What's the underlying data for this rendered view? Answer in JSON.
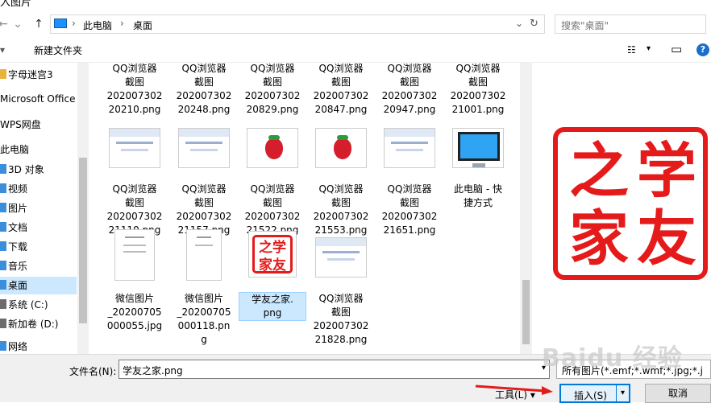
{
  "window": {
    "title_fragment": "入图片"
  },
  "nav": {
    "back": "←",
    "forward": "→",
    "down": "⌄",
    "up": "↑"
  },
  "address": {
    "crumb1": "此电脑",
    "crumb2": "桌面",
    "dropdown": "⌄",
    "refresh": "↻"
  },
  "search": {
    "placeholder": "搜索\"桌面\""
  },
  "toolbar": {
    "new_folder": "新建文件夹",
    "view_label": "☷",
    "view_arrow": "▾",
    "pane_icon": "▭",
    "help": "?"
  },
  "left_pane": [
    {
      "label": "字母迷宫3",
      "icon": "folder-icon",
      "color": "#e8b33c"
    },
    {
      "label": "Microsoft Office",
      "icon": "",
      "color": ""
    },
    {
      "label": "WPS网盘",
      "icon": "",
      "color": ""
    },
    {
      "label": "此电脑",
      "icon": "",
      "color": ""
    },
    {
      "label": "3D 对象",
      "icon": "3d-objects-icon",
      "color": "#3b8edb"
    },
    {
      "label": "视频",
      "icon": "videos-icon",
      "color": "#3b8edb"
    },
    {
      "label": "图片",
      "icon": "pictures-icon",
      "color": "#3b8edb"
    },
    {
      "label": "文档",
      "icon": "documents-icon",
      "color": "#3b8edb"
    },
    {
      "label": "下载",
      "icon": "downloads-icon",
      "color": "#3b8edb"
    },
    {
      "label": "音乐",
      "icon": "music-icon",
      "color": "#3b8edb"
    },
    {
      "label": "桌面",
      "icon": "desktop-icon",
      "color": "#3b8edb",
      "selected": true
    },
    {
      "label": "系统 (C:)",
      "icon": "drive-icon",
      "color": "#6c6c6c"
    },
    {
      "label": "新加卷 (D:)",
      "icon": "drive-icon",
      "color": "#6c6c6c"
    },
    {
      "label": "网络",
      "icon": "network-icon",
      "color": "#3b8edb"
    }
  ],
  "files_row1": [
    {
      "l1": "QQ浏览器",
      "l2": "截图",
      "l3": "202007302",
      "l4": "20210.png"
    },
    {
      "l1": "QQ浏览器",
      "l2": "截图",
      "l3": "202007302",
      "l4": "20248.png"
    },
    {
      "l1": "QQ浏览器",
      "l2": "截图",
      "l3": "202007302",
      "l4": "20829.png"
    },
    {
      "l1": "QQ浏览器",
      "l2": "截图",
      "l3": "202007302",
      "l4": "20847.png"
    },
    {
      "l1": "QQ浏览器",
      "l2": "截图",
      "l3": "202007302",
      "l4": "20947.png"
    },
    {
      "l1": "QQ浏览器",
      "l2": "截图",
      "l3": "202007302",
      "l4": "21001.png"
    }
  ],
  "files_row2": [
    {
      "l1": "QQ浏览器",
      "l2": "截图",
      "l3": "202007302",
      "l4": "21110.png"
    },
    {
      "l1": "QQ浏览器",
      "l2": "截图",
      "l3": "202007302",
      "l4": "21157.png"
    },
    {
      "l1": "QQ浏览器",
      "l2": "截图",
      "l3": "202007302",
      "l4": "21522.png"
    },
    {
      "l1": "QQ浏览器",
      "l2": "截图",
      "l3": "202007302",
      "l4": "21553.png"
    },
    {
      "l1": "QQ浏览器",
      "l2": "截图",
      "l3": "202007302",
      "l4": "21651.png"
    },
    {
      "l1": "此电脑 - 快",
      "l2": "捷方式",
      "l3": "",
      "l4": ""
    }
  ],
  "files_row3": [
    {
      "l1": "微信图片",
      "l2": "_20200705",
      "l3": "000055.jpg",
      "l4": ""
    },
    {
      "l1": "微信图片",
      "l2": "_20200705",
      "l3": "000118.pn",
      "l4": "g"
    },
    {
      "l1": "学友之家.",
      "l2": "png",
      "l3": "",
      "l4": ""
    },
    {
      "l1": "QQ浏览器",
      "l2": "截图",
      "l3": "202007302",
      "l4": "21828.png"
    }
  ],
  "seal": {
    "c1": "学",
    "c2": "之",
    "c3": "家",
    "c4": "友",
    "color": "#e51a1a"
  },
  "bottom": {
    "filename_label": "文件名(N):",
    "filename_value": "学友之家.png",
    "filter": "所有图片(*.emf;*.wmf;*.jpg;*.j",
    "tools": "工具(L)  ▾",
    "insert": "插入(S)",
    "insert_split": "▾",
    "cancel": "取消"
  },
  "watermark": "Baidu 经验"
}
